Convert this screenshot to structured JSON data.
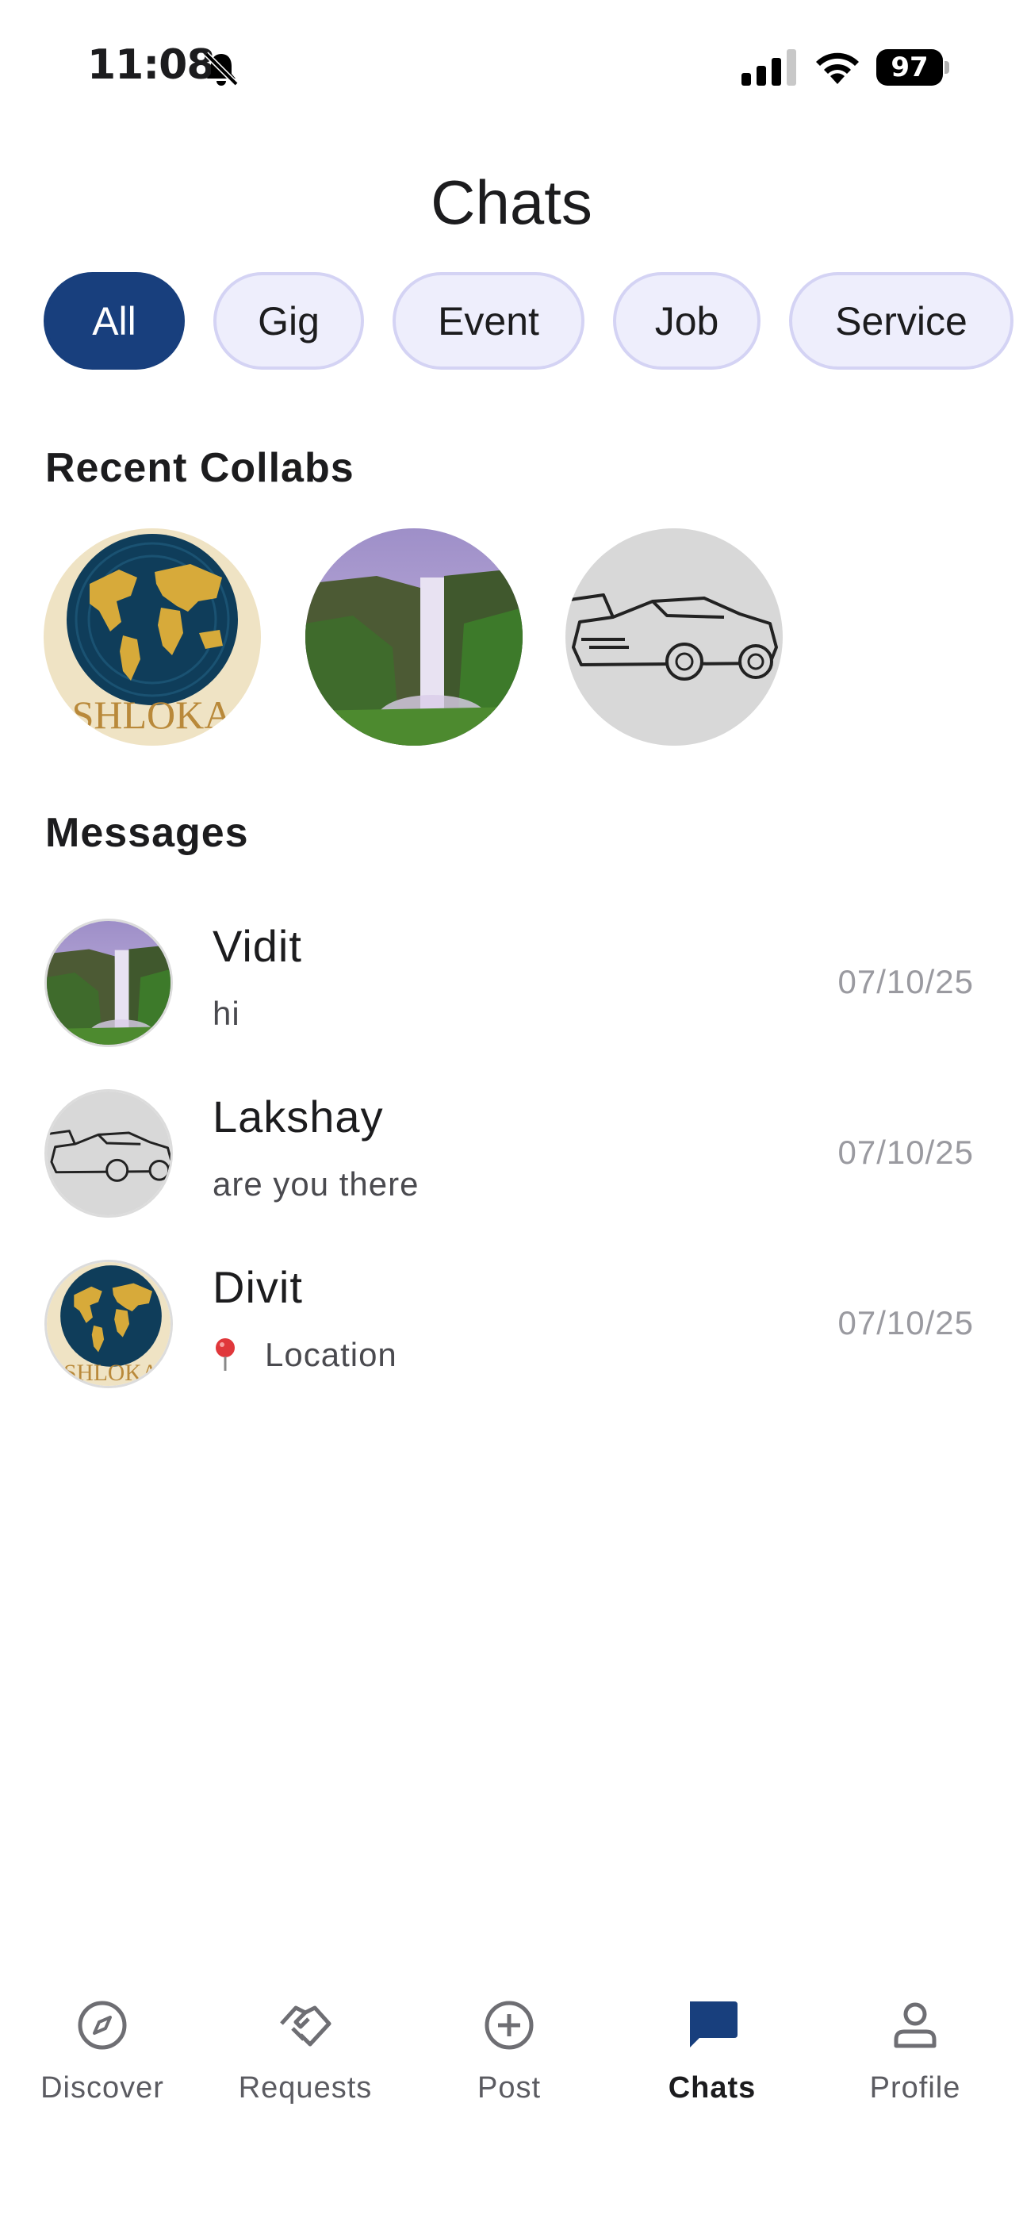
{
  "status_bar": {
    "time": "11:08",
    "battery": "97",
    "icons": [
      "bell-slash-icon",
      "signal-icon",
      "wifi-icon",
      "battery-icon"
    ]
  },
  "title": "Chats",
  "filters": {
    "all": "All",
    "gig": "Gig",
    "event": "Event",
    "job": "Job",
    "service": "Service",
    "selected": "All"
  },
  "recent_collabs": {
    "heading": "Recent Collabs",
    "items": [
      {
        "avatar": "globe-logo",
        "logo_text": "SHLOKA"
      },
      {
        "avatar": "waterfall-photo"
      },
      {
        "avatar": "sports-car-sketch"
      }
    ]
  },
  "messages": {
    "heading": "Messages",
    "items": [
      {
        "name": "Vidit",
        "preview": "hi",
        "date": "07/10/25",
        "avatar": "waterfall-photo"
      },
      {
        "name": "Lakshay",
        "preview": "are you there",
        "date": "07/10/25",
        "avatar": "sports-car-sketch"
      },
      {
        "name": "Divit",
        "preview": "Location",
        "preview_icon": "pin-icon",
        "date": "07/10/25",
        "avatar": "globe-logo",
        "logo_text": "SHLOKA"
      }
    ]
  },
  "nav": {
    "discover": "Discover",
    "requests": "Requests",
    "post": "Post",
    "chats": "Chats",
    "profile": "Profile",
    "active": "Chats"
  },
  "colors": {
    "accent": "#183f7d",
    "chip_bg": "#eeeefc",
    "chip_border": "#d4d3f4",
    "date_gray": "#9a9aa0"
  }
}
